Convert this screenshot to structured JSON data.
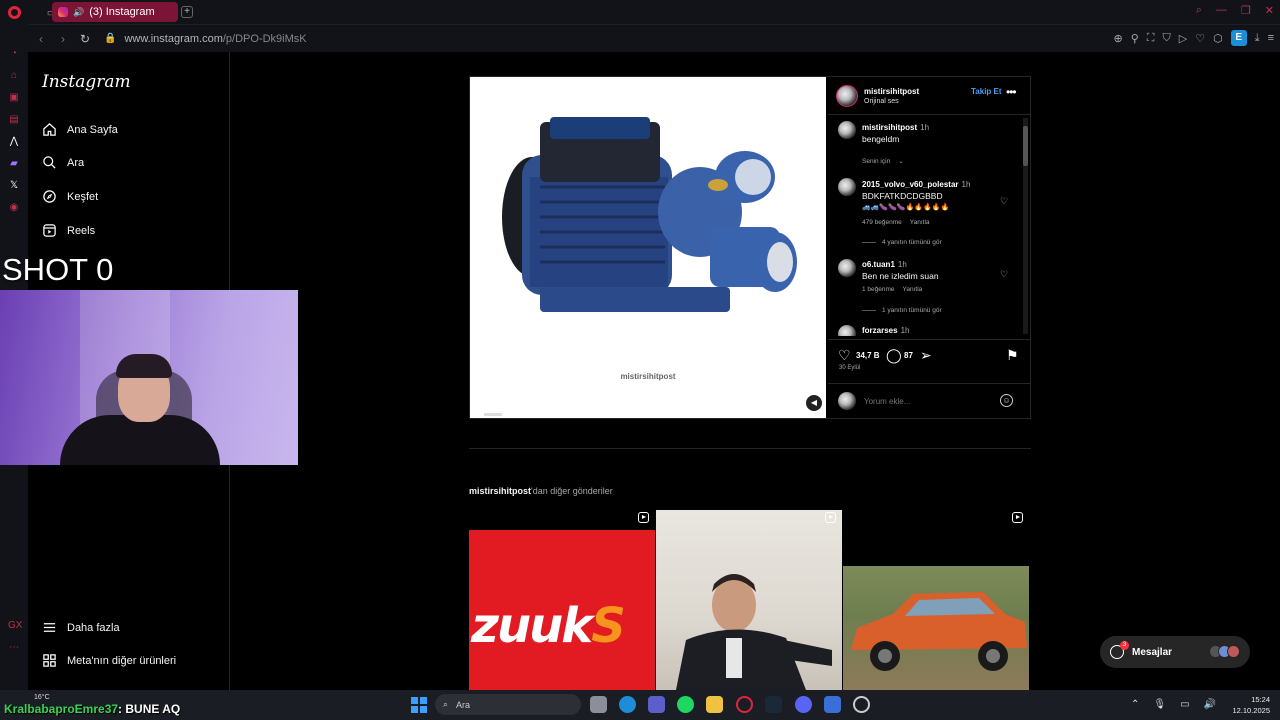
{
  "browser": {
    "tab_title": "(3) Instagram",
    "url_host": "www.instagram.com",
    "url_path": "/p/DPO-Dk9iMsK",
    "extension_badge": "E",
    "colors": {
      "tab_active": "#7c1535",
      "accent": "#e0243d"
    }
  },
  "instagram": {
    "logo": "Instagram",
    "nav": {
      "home": "Ana Sayfa",
      "search": "Ara",
      "explore": "Keşfet",
      "reels": "Reels",
      "more": "Daha fazla",
      "meta": "Meta'nın diğer ürünleri"
    },
    "post": {
      "username": "mistirsihitpost",
      "audio": "Orijinal ses",
      "follow": "Takip Et",
      "watermark": "mistirsihitpost",
      "likes": "34,7 B",
      "comments_count": "87",
      "date": "30 Eylül",
      "comment_placeholder": "Yorum ekle...",
      "comments": [
        {
          "user": "mistirsihitpost",
          "time": "1h",
          "text": "bengeldm",
          "extra": "Senin için"
        },
        {
          "user": "2015_volvo_v60_polestar",
          "time": "1h",
          "text": "BDKFATKDCDGBBD",
          "likes": "479 beğenme",
          "reply": "Yanıtla",
          "replies": "4 yanıtın tümünü gör"
        },
        {
          "user": "o6.tuan1",
          "time": "1h",
          "text": "Ben ne izledim suan",
          "likes": "1 beğenme",
          "reply": "Yanıtla",
          "replies": "1 yanıtın tümünü gör"
        },
        {
          "user": "forzarses",
          "time": "1h"
        }
      ]
    },
    "more_posts": {
      "user": "mistirsihitpost",
      "suffix": "'dan diğer gönderiler",
      "brand_text": "zuuk",
      "brand_s": "S"
    },
    "messages": {
      "label": "Mesajlar",
      "badge": "3"
    }
  },
  "stream": {
    "shot_label": "SHOT 0",
    "chat_user": "KralbabaproEmre37",
    "chat_message": ": BUNE AQ"
  },
  "taskbar": {
    "weather": "16°C",
    "search_placeholder": "Ara",
    "time": "15:24",
    "date": "12.10.2025"
  }
}
